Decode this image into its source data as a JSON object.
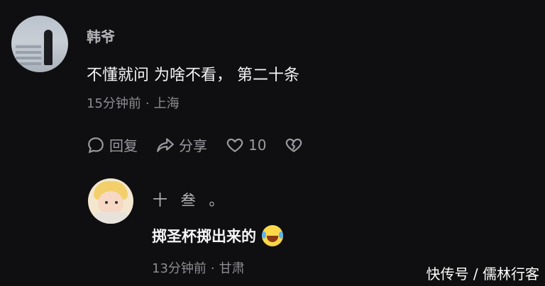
{
  "comment": {
    "author": "韩爷",
    "text": "不懂就问 为啥不看， 第二十条",
    "time": "15分钟前",
    "separator": "·",
    "location": "上海",
    "actions": {
      "reply_label": "回复",
      "share_label": "分享",
      "like_count": "10"
    }
  },
  "reply": {
    "author": "十 叁 。",
    "text": "掷圣杯掷出来的",
    "emoji": "rolling-laughing-emoji",
    "time": "13分钟前",
    "separator": "·",
    "location": "甘肃"
  },
  "watermark": "快传号 / 儒林行客",
  "colors": {
    "background": "#0f0f11",
    "primary_text": "#f5f5f7",
    "secondary_text": "#8c8c92"
  }
}
